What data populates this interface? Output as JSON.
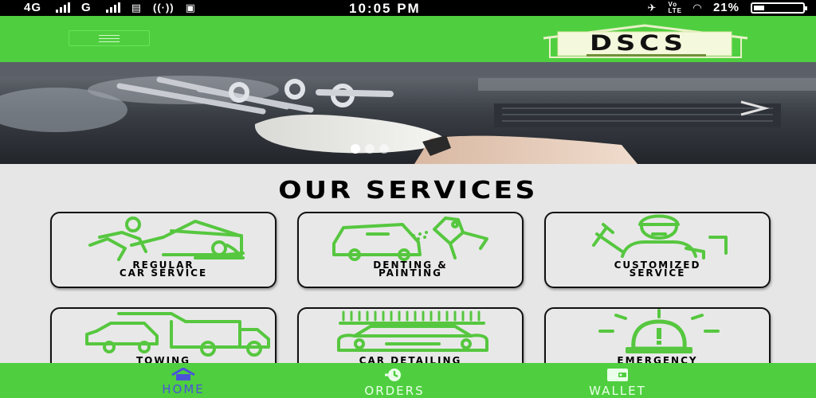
{
  "status_bar": {
    "left_network_1": "4G",
    "left_network_2": "G",
    "time": "10:05 PM",
    "volte": "Vo\nLTE",
    "battery": "21%",
    "battery_level": 0.21
  },
  "app_bar": {
    "menu_icon": "hamburger-menu-icon",
    "logo_text": "DSCS"
  },
  "hero": {
    "slide_count": 3,
    "active_slide": 0
  },
  "services": {
    "title": "OUR SERVICES",
    "items": [
      {
        "label": "REGULAR\nCAR SERVICE",
        "icon": "mechanic-icon"
      },
      {
        "label": "DENTING &\nPAINTING",
        "icon": "spray-painting-icon"
      },
      {
        "label": "CUSTOMIZED\nSERVICE",
        "icon": "technician-icon"
      },
      {
        "label": "TOWING",
        "icon": "tow-truck-icon"
      },
      {
        "label": "CAR DETAILING",
        "icon": "car-wash-icon"
      },
      {
        "label": "EMERGENCY",
        "icon": "siren-icon"
      }
    ]
  },
  "bottom_nav": {
    "items": [
      {
        "label": "HOME",
        "icon": "home-icon",
        "active": true
      },
      {
        "label": "ORDERS",
        "icon": "orders-icon",
        "active": false
      },
      {
        "label": "WALLET",
        "icon": "wallet-icon",
        "active": false
      }
    ]
  },
  "colors": {
    "brand_green": "#4fcf3f",
    "icon_green": "#56c73f",
    "active_nav": "#4b54d8"
  }
}
